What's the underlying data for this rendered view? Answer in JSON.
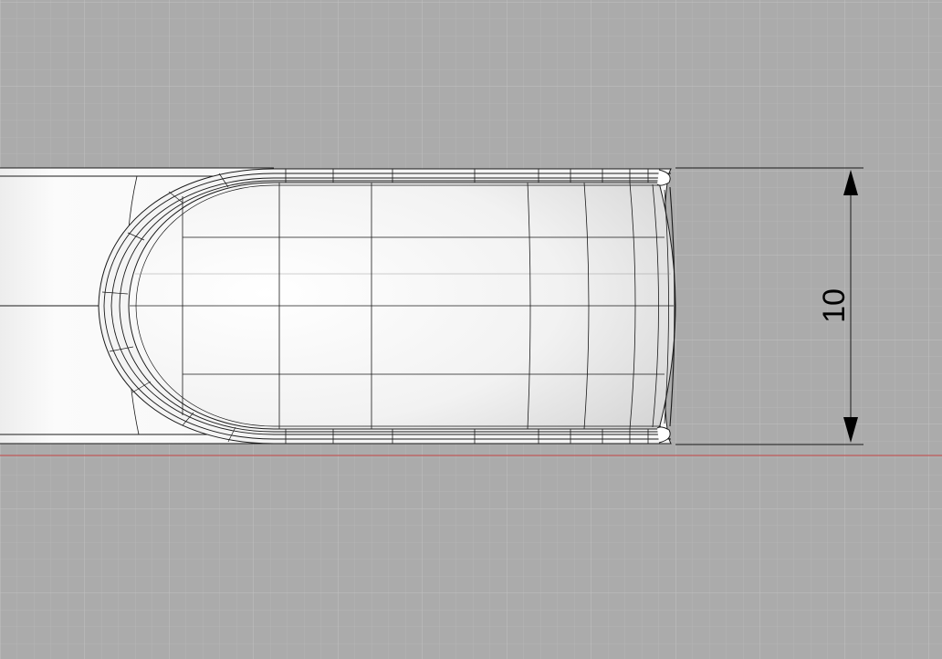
{
  "viewport": {
    "colors": {
      "background": "#ababab",
      "grid_minor": "#b6b6b6",
      "grid_major": "#c2c2c2",
      "x_axis": "#c05a5a",
      "model_fill": "#f3f3f3",
      "wireframe": "#1a1a1a"
    }
  },
  "dimension": {
    "value": "10",
    "icon_top": "arrow-up",
    "icon_bottom": "arrow-down"
  }
}
